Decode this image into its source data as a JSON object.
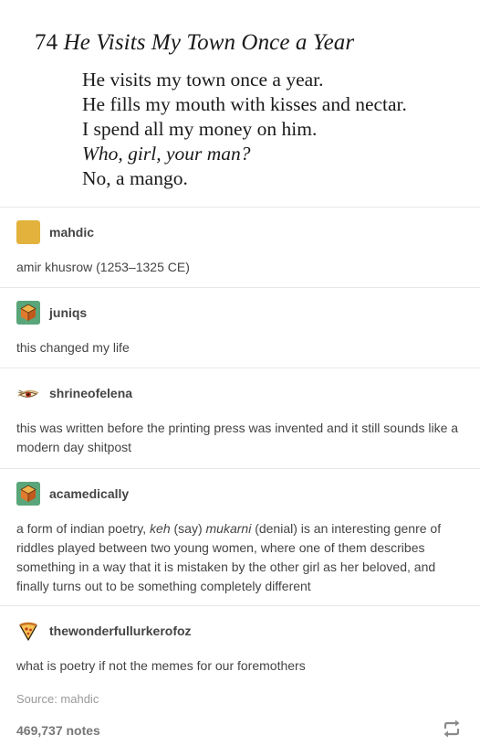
{
  "poem": {
    "number": "74",
    "title": "He Visits My Town Once a Year",
    "lines": [
      "He visits my town once a year.",
      "He fills my mouth with kisses and nectar.",
      "I spend all my money on him.",
      "Who, girl, your man?",
      "No, a mango."
    ]
  },
  "reblogs": [
    {
      "username": "mahdic",
      "avatar_icon": "mustard-square-avatar",
      "avatar_color": "#E3B23C",
      "text": "amir khusrow (1253–1325 CE)"
    },
    {
      "username": "juniqs",
      "avatar_icon": "cube-avatar",
      "text": "this changed my life"
    },
    {
      "username": "shrineofelena",
      "avatar_icon": "eye-avatar",
      "text": "this was written before the printing press was invented and it still sounds like a modern day shitpost"
    },
    {
      "username": "acamedically",
      "avatar_icon": "cube-avatar",
      "text_before_keh": "a form of indian poetry, ",
      "keh": "keh",
      "text_say": " (say) ",
      "mukarni": "mukarni",
      "text_after": " (denial) is an interesting genre of riddles played between two young women, where one of them describes something in a way that it is mistaken by the other girl as her beloved, and finally turns out to be something completely different"
    },
    {
      "username": "thewonderfullurkerofoz",
      "avatar_icon": "pizza-slice-avatar",
      "text": "what is poetry if not the memes for our foremothers"
    }
  ],
  "source": "Source: mahdic",
  "notes": "469,737 notes",
  "actions": {
    "reblog_icon": "reblog-icon"
  },
  "colors": {
    "text": "#444444",
    "muted": "#999999",
    "divider": "#e8e8e8",
    "reblog_icon": "#8a8a8a"
  }
}
